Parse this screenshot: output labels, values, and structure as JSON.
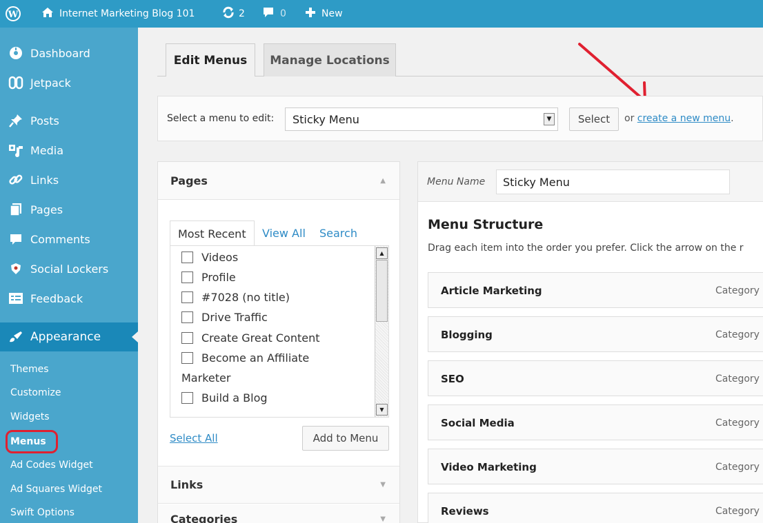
{
  "adminbar": {
    "site_name": "Internet Marketing Blog 101",
    "updates_count": "2",
    "comments_count": "0",
    "new_label": "New"
  },
  "sidebar": {
    "items": [
      {
        "label": "Dashboard",
        "icon": "dashboard-icon"
      },
      {
        "label": "Jetpack",
        "icon": "jetpack-icon"
      },
      {
        "label": "Posts",
        "icon": "pin-icon"
      },
      {
        "label": "Media",
        "icon": "media-icon"
      },
      {
        "label": "Links",
        "icon": "link-icon"
      },
      {
        "label": "Pages",
        "icon": "page-icon"
      },
      {
        "label": "Comments",
        "icon": "comment-icon"
      },
      {
        "label": "Social Lockers",
        "icon": "shield-icon"
      },
      {
        "label": "Feedback",
        "icon": "feedback-icon"
      },
      {
        "label": "Appearance",
        "icon": "brush-icon"
      }
    ],
    "submenu": [
      "Themes",
      "Customize",
      "Widgets",
      "Menus",
      "Ad Codes Widget",
      "Ad Squares Widget",
      "Swift Options"
    ]
  },
  "tabs": {
    "edit": "Edit Menus",
    "manage": "Manage Locations"
  },
  "select_bar": {
    "label": "Select a menu to edit:",
    "selected": "Sticky Menu",
    "button": "Select",
    "or_text": "or",
    "link": "create a new menu",
    "period": "."
  },
  "pages_box": {
    "title": "Pages",
    "tabs": [
      "Most Recent",
      "View All",
      "Search"
    ],
    "items": [
      "Videos",
      "Profile",
      "#7028 (no title)",
      "Drive Traffic",
      "Create Great Content",
      "Become an Affiliate",
      "Build a Blog"
    ],
    "wrap_text": "Marketer",
    "select_all": "Select All",
    "add_button": "Add to Menu",
    "links_title": "Links",
    "categories_title": "Categories"
  },
  "menu_panel": {
    "name_label": "Menu Name",
    "name_value": "Sticky Menu",
    "structure_title": "Menu Structure",
    "structure_desc": "Drag each item into the order you prefer. Click the arrow on the r",
    "items": [
      {
        "title": "Article Marketing",
        "type": "Category"
      },
      {
        "title": "Blogging",
        "type": "Category"
      },
      {
        "title": "SEO",
        "type": "Category"
      },
      {
        "title": "Social Media",
        "type": "Category"
      },
      {
        "title": "Video Marketing",
        "type": "Category"
      },
      {
        "title": "Reviews",
        "type": "Category"
      }
    ]
  },
  "colors": {
    "adminbar": "#2e9bc6",
    "sidebar": "#4aa6cc",
    "active": "#1a88b8",
    "link": "#2e8bc6",
    "annotation": "#e02030"
  }
}
